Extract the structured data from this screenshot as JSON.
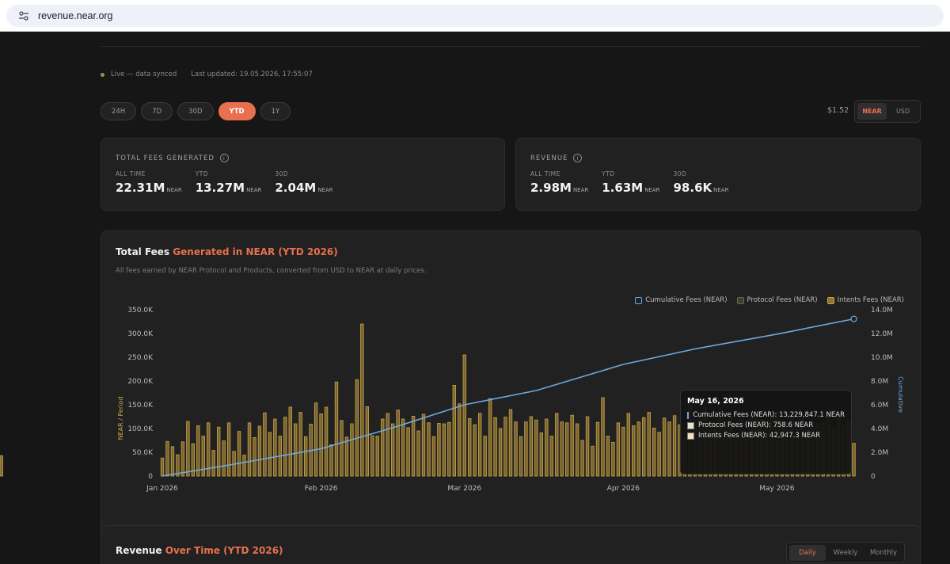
{
  "browser": {
    "url": "revenue.near.org"
  },
  "status": {
    "live": "Live — data synced",
    "updated": "Last updated: 19.05.2026, 17:55:07"
  },
  "ranges": [
    {
      "label": "24H",
      "active": false
    },
    {
      "label": "7D",
      "active": false
    },
    {
      "label": "30D",
      "active": false
    },
    {
      "label": "YTD",
      "active": true
    },
    {
      "label": "1Y",
      "active": false
    }
  ],
  "price": "$1.52",
  "currency": {
    "near": "NEAR",
    "usd": "USD",
    "selected": "NEAR"
  },
  "fees_card": {
    "title": "TOTAL FEES GENERATED",
    "items": [
      {
        "label": "ALL TIME",
        "value": "22.31M",
        "unit": "NEAR"
      },
      {
        "label": "YTD",
        "value": "13.27M",
        "unit": "NEAR"
      },
      {
        "label": "30D",
        "value": "2.04M",
        "unit": "NEAR"
      }
    ]
  },
  "revenue_card": {
    "title": "REVENUE",
    "items": [
      {
        "label": "ALL TIME",
        "value": "2.98M",
        "unit": "NEAR"
      },
      {
        "label": "YTD",
        "value": "1.63M",
        "unit": "NEAR"
      },
      {
        "label": "30D",
        "value": "98.6K",
        "unit": "NEAR"
      }
    ]
  },
  "fees_chart": {
    "title_main": "Total Fees",
    "title_accent": "Generated in NEAR (YTD 2026)",
    "subtitle": "All fees earned by NEAR Protocol and Products, converted from USD to NEAR at daily prices."
  },
  "chart_data": {
    "type": "bar",
    "x": [
      "2026-01-01",
      "2026-01-02",
      "2026-01-03",
      "2026-01-04",
      "2026-01-05",
      "2026-01-06",
      "2026-01-07",
      "2026-01-08",
      "2026-01-09",
      "2026-01-10",
      "2026-01-11",
      "2026-01-12",
      "2026-01-13",
      "2026-01-14",
      "2026-01-15",
      "2026-01-16",
      "2026-01-17",
      "2026-01-18",
      "2026-01-19",
      "2026-01-20",
      "2026-01-21",
      "2026-01-22",
      "2026-01-23",
      "2026-01-24",
      "2026-01-25",
      "2026-01-26",
      "2026-01-27",
      "2026-01-28",
      "2026-01-29",
      "2026-01-30",
      "2026-01-31",
      "2026-02-01",
      "2026-02-02",
      "2026-02-03",
      "2026-02-04",
      "2026-02-05",
      "2026-02-06",
      "2026-02-07",
      "2026-02-08",
      "2026-02-09",
      "2026-02-10",
      "2026-02-11",
      "2026-02-12",
      "2026-02-13",
      "2026-02-14",
      "2026-02-15",
      "2026-02-16",
      "2026-02-17",
      "2026-02-18",
      "2026-02-19",
      "2026-02-20",
      "2026-02-21",
      "2026-02-22",
      "2026-02-23",
      "2026-02-24",
      "2026-02-25",
      "2026-02-26",
      "2026-02-27",
      "2026-02-28",
      "2026-03-01",
      "2026-03-02",
      "2026-03-03",
      "2026-03-04",
      "2026-03-05",
      "2026-03-06",
      "2026-03-07",
      "2026-03-08",
      "2026-03-09",
      "2026-03-10",
      "2026-03-11",
      "2026-03-12",
      "2026-03-13",
      "2026-03-14",
      "2026-03-15",
      "2026-03-16",
      "2026-03-17",
      "2026-03-18",
      "2026-03-19",
      "2026-03-20",
      "2026-03-21",
      "2026-03-22",
      "2026-03-23",
      "2026-03-24",
      "2026-03-25",
      "2026-03-26",
      "2026-03-27",
      "2026-03-28",
      "2026-03-29",
      "2026-03-30",
      "2026-03-31",
      "2026-04-01",
      "2026-04-02",
      "2026-04-03",
      "2026-04-04",
      "2026-04-05",
      "2026-04-06",
      "2026-04-07",
      "2026-04-08",
      "2026-04-09",
      "2026-04-10",
      "2026-04-11",
      "2026-04-12",
      "2026-04-13",
      "2026-04-14",
      "2026-04-15",
      "2026-04-16",
      "2026-04-17",
      "2026-04-18",
      "2026-04-19",
      "2026-04-20",
      "2026-04-21",
      "2026-04-22",
      "2026-04-23",
      "2026-04-24",
      "2026-04-25",
      "2026-04-26",
      "2026-04-27",
      "2026-04-28",
      "2026-04-29",
      "2026-04-30",
      "2026-05-01",
      "2026-05-02",
      "2026-05-03",
      "2026-05-04",
      "2026-05-05",
      "2026-05-06",
      "2026-05-07",
      "2026-05-08",
      "2026-05-09",
      "2026-05-10",
      "2026-05-11",
      "2026-05-12",
      "2026-05-13",
      "2026-05-14",
      "2026-05-15",
      "2026-05-16"
    ],
    "x_ticks": [
      "Jan 2026",
      "Feb 2026",
      "Mar 2026",
      "Apr 2026",
      "May 2026"
    ],
    "series": [
      {
        "name": "Intents Fees (NEAR)",
        "axis": "left",
        "color": "#c8a24a",
        "values": [
          38000,
          73000,
          62000,
          45000,
          72000,
          115000,
          68000,
          106000,
          84000,
          112000,
          54000,
          103000,
          74000,
          112000,
          52000,
          94000,
          44000,
          112000,
          81000,
          105000,
          133000,
          92000,
          120000,
          84000,
          124000,
          145000,
          110000,
          134000,
          83000,
          109000,
          154000,
          131000,
          145000,
          66000,
          198000,
          117000,
          82000,
          110000,
          203000,
          320000,
          146000,
          85000,
          84000,
          120000,
          132000,
          110000,
          139000,
          120000,
          102000,
          126000,
          95000,
          130000,
          112000,
          83000,
          111000,
          110000,
          113000,
          191000,
          152000,
          255000,
          121000,
          108000,
          132000,
          84000,
          163000,
          123000,
          100000,
          124000,
          140000,
          114000,
          83000,
          114000,
          125000,
          118000,
          91000,
          120000,
          84000,
          132000,
          114000,
          112000,
          128000,
          110000,
          75000,
          125000,
          63000,
          113000,
          165000,
          84000,
          71000,
          112000,
          103000,
          132000,
          106000,
          114000,
          123000,
          134000,
          101000,
          92000,
          122000,
          114000,
          127000,
          108000,
          78000,
          155000,
          120000,
          132000,
          145000,
          115000,
          112000,
          126000,
          108000,
          122000,
          78000,
          135000,
          80000,
          135000,
          120000,
          118000,
          114000,
          126000,
          134000,
          110000,
          96000,
          125000,
          114000,
          120000,
          97000,
          112000,
          110000,
          110000,
          128000,
          100000,
          124000,
          106000,
          115000,
          69000,
          42947
        ],
        "tooltip_value": "42,947.3 NEAR"
      },
      {
        "name": "Protocol Fees (NEAR)",
        "axis": "left",
        "color": "#5a5a3a",
        "tooltip_value": "758.6 NEAR"
      },
      {
        "name": "Cumulative Fees (NEAR)",
        "axis": "right",
        "type": "line",
        "color": "#6fa8dc",
        "points": [
          [
            "2026-01-01",
            0
          ],
          [
            "2026-01-15",
            1000000
          ],
          [
            "2026-02-01",
            2300000
          ],
          [
            "2026-02-16",
            4200000
          ],
          [
            "2026-03-01",
            6000000
          ],
          [
            "2026-03-15",
            7200000
          ],
          [
            "2026-04-01",
            9400000
          ],
          [
            "2026-04-15",
            10700000
          ],
          [
            "2026-05-01",
            11950000
          ],
          [
            "2026-05-16",
            13229847.1
          ]
        ],
        "tooltip_value": "13,229,847.1 NEAR"
      }
    ],
    "ylabel": "NEAR / Period",
    "ylim": [
      0,
      350000
    ],
    "y_ticks": [
      "0",
      "50.0K",
      "100.0K",
      "150.0K",
      "200.0K",
      "250.0K",
      "300.0K",
      "350.0K"
    ],
    "y2label": "Cumulative",
    "y2lim": [
      0,
      14000000
    ],
    "y2_ticks": [
      "0",
      "2.0M",
      "4.0M",
      "6.0M",
      "8.0M",
      "10.0M",
      "12.0M",
      "14.0M"
    ],
    "legend_position": "top-right",
    "grid": false,
    "tooltip_date": "May 16, 2026"
  },
  "legend": {
    "cumulative": "Cumulative Fees (NEAR)",
    "protocol": "Protocol Fees (NEAR)",
    "intents": "Intents Fees (NEAR)"
  },
  "tooltip": {
    "date": "May 16, 2026",
    "cumulative": "Cumulative Fees (NEAR): 13,229,847.1 NEAR",
    "protocol": "Protocol Fees (NEAR): 758.6 NEAR",
    "intents": "Intents Fees (NEAR): 42,947.3 NEAR"
  },
  "revenue_chart": {
    "title_main": "Revenue",
    "title_accent": "Over Time (YTD 2026)",
    "tabs": [
      {
        "label": "Daily",
        "active": true
      },
      {
        "label": "Weekly",
        "active": false
      },
      {
        "label": "Monthly",
        "active": false
      }
    ]
  },
  "colors": {
    "accent": "#e8704f",
    "bar": "#c8a24a",
    "line": "#6fa8dc",
    "protocol": "#5a5a3a"
  }
}
